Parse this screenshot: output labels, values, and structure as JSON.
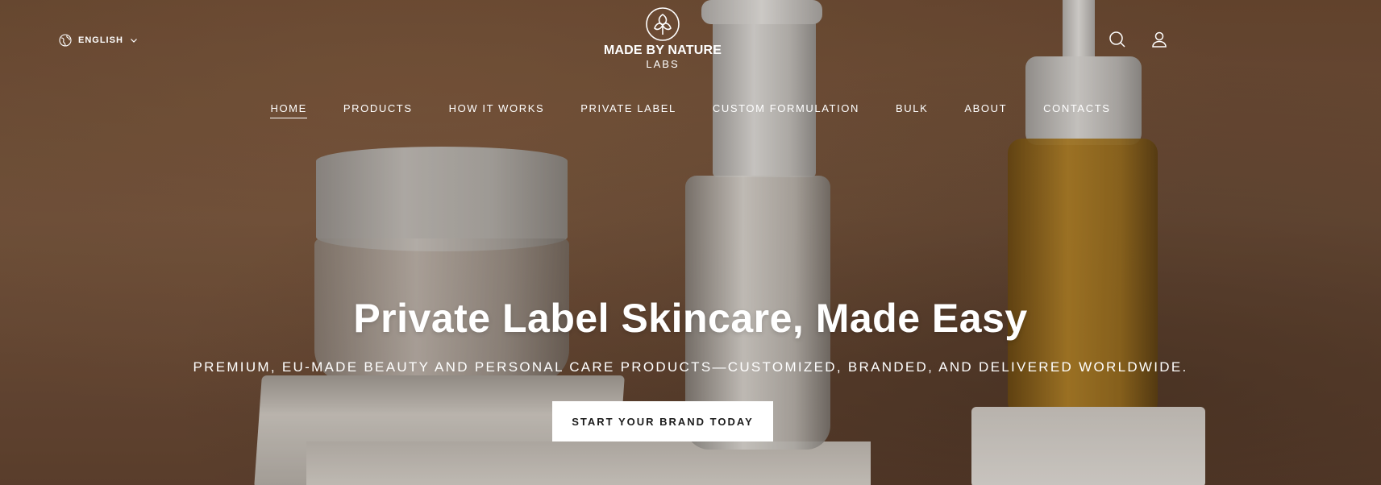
{
  "header": {
    "language": {
      "label": "ENGLISH",
      "icon": "globe-icon",
      "chevron": "chevron-down-icon"
    },
    "logo": {
      "name": "MADE BY NATURE",
      "sub": "LABS"
    },
    "icons": {
      "search": "search-icon",
      "account": "user-icon"
    }
  },
  "nav": {
    "items": [
      {
        "label": "HOME",
        "active": true
      },
      {
        "label": "PRODUCTS"
      },
      {
        "label": "HOW IT WORKS"
      },
      {
        "label": "PRIVATE LABEL"
      },
      {
        "label": "CUSTOM FORMULATION"
      },
      {
        "label": "BULK"
      },
      {
        "label": "ABOUT"
      },
      {
        "label": "CONTACTS"
      }
    ]
  },
  "hero": {
    "title": "Private Label Skincare, Made Easy",
    "subtitle": "PREMIUM, EU-MADE BEAUTY AND PERSONAL CARE PRODUCTS—CUSTOMIZED, BRANDED, AND DELIVERED WORLDWIDE.",
    "cta": "START YOUR BRAND TODAY"
  },
  "colors": {
    "accent": "#ffffff",
    "background": "#6b4a33",
    "cta_text": "#1b1b1b"
  }
}
